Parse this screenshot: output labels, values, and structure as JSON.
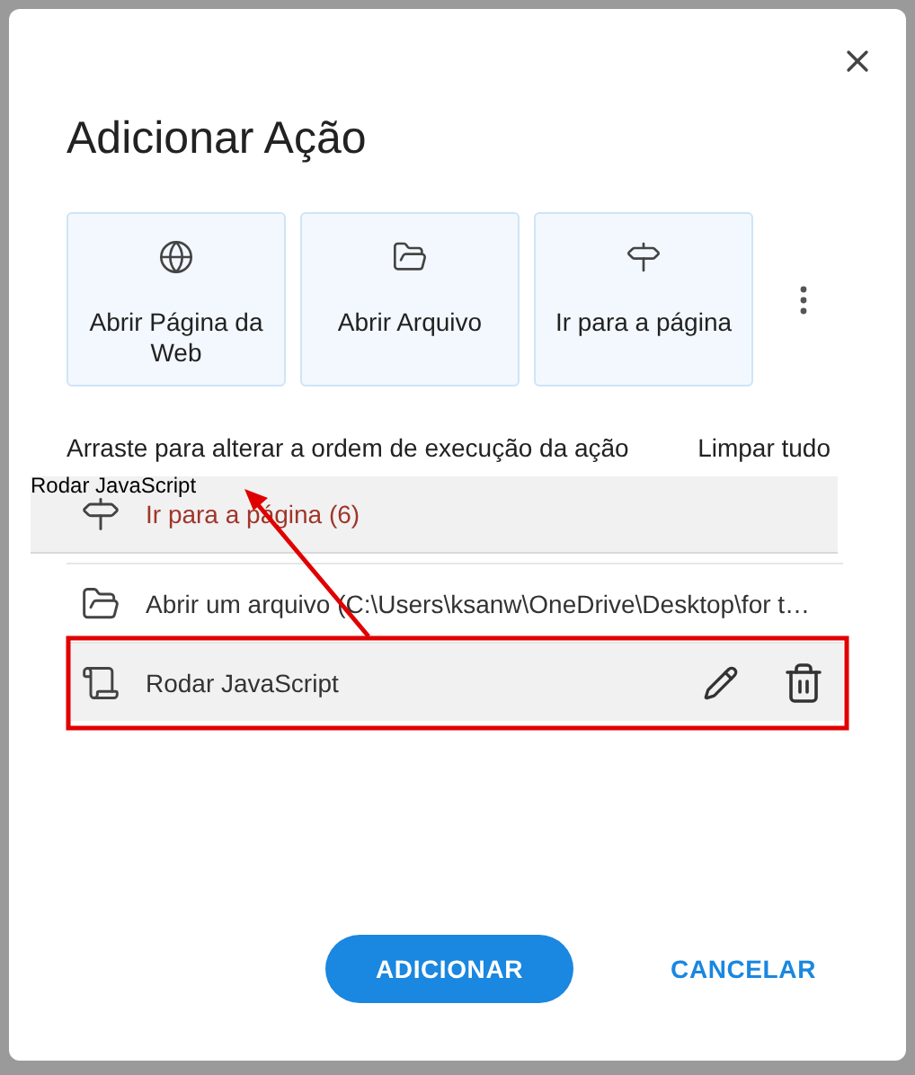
{
  "dialog": {
    "title": "Adicionar Ação"
  },
  "actions": [
    {
      "kind": "web",
      "label": "Abrir Página da Web"
    },
    {
      "kind": "file",
      "label": "Abrir Arquivo"
    },
    {
      "kind": "goto",
      "label": "Ir para a página"
    }
  ],
  "instruction": "Arraste para alterar a ordem de execução da ação",
  "clear_all": "Limpar tudo",
  "drag_label": "Rodar JavaScript",
  "steps": [
    {
      "kind": "goto",
      "label": "Ir para a página (6)",
      "dragging": true,
      "selected": false
    },
    {
      "kind": "file",
      "label": "Abrir um arquivo (C:\\Users\\ksanw\\OneDrive\\Desktop\\for t…",
      "dragging": false,
      "selected": false
    },
    {
      "kind": "script",
      "label": "Rodar JavaScript",
      "dragging": false,
      "selected": true
    }
  ],
  "buttons": [
    {
      "kind": "primary",
      "label": "ADICIONAR"
    },
    {
      "kind": "text",
      "label": "CANCELAR"
    }
  ]
}
